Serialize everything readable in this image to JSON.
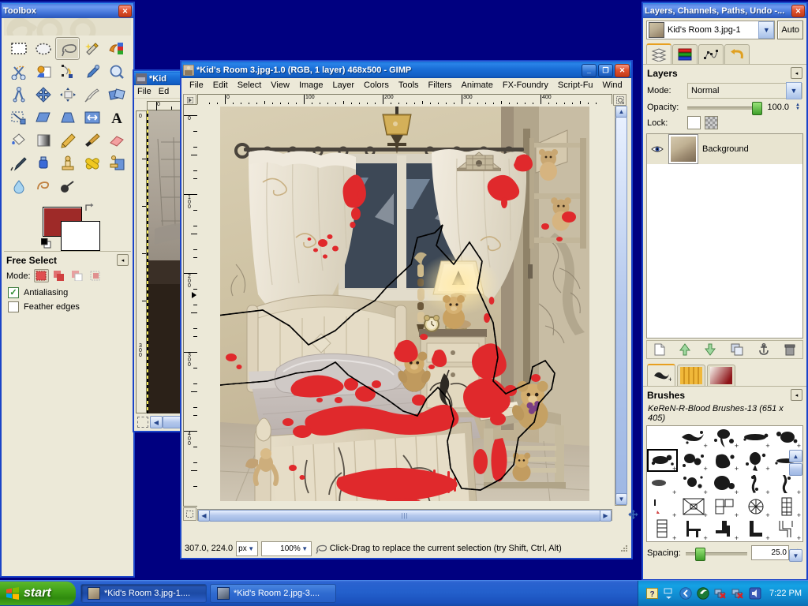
{
  "desktop": {
    "background_color": "#000080"
  },
  "toolbox": {
    "title": "Toolbox",
    "close_label": "✕",
    "tools": [
      {
        "name": "rect-select-tool",
        "label": "Rectangle Select",
        "selected": false
      },
      {
        "name": "ellipse-select-tool",
        "label": "Ellipse Select",
        "selected": false
      },
      {
        "name": "free-select-tool",
        "label": "Free Select",
        "selected": true
      },
      {
        "name": "fuzzy-select-tool",
        "label": "Fuzzy Select",
        "selected": false
      },
      {
        "name": "select-by-color-tool",
        "label": "Select by Color",
        "selected": false
      },
      {
        "name": "scissors-select-tool",
        "label": "Scissors Select",
        "selected": false
      },
      {
        "name": "foreground-select-tool",
        "label": "Foreground Select",
        "selected": false
      },
      {
        "name": "paths-tool",
        "label": "Paths",
        "selected": false
      },
      {
        "name": "color-picker-tool",
        "label": "Color Picker",
        "selected": false
      },
      {
        "name": "zoom-tool",
        "label": "Zoom",
        "selected": false
      },
      {
        "name": "measure-tool",
        "label": "Measure",
        "selected": false
      },
      {
        "name": "move-tool",
        "label": "Move",
        "selected": false
      },
      {
        "name": "alignment-tool",
        "label": "Alignment",
        "selected": false
      },
      {
        "name": "crop-tool",
        "label": "Crop",
        "selected": false
      },
      {
        "name": "rotate-tool",
        "label": "Rotate",
        "selected": false
      },
      {
        "name": "scale-tool",
        "label": "Scale",
        "selected": false
      },
      {
        "name": "shear-tool",
        "label": "Shear",
        "selected": false
      },
      {
        "name": "perspective-tool",
        "label": "Perspective",
        "selected": false
      },
      {
        "name": "flip-tool",
        "label": "Flip",
        "selected": false
      },
      {
        "name": "text-tool",
        "label": "Text",
        "selected": false
      },
      {
        "name": "bucket-fill-tool",
        "label": "Bucket Fill",
        "selected": false
      },
      {
        "name": "gradient-tool",
        "label": "Blend",
        "selected": false
      },
      {
        "name": "pencil-tool",
        "label": "Pencil",
        "selected": false
      },
      {
        "name": "paintbrush-tool",
        "label": "Paintbrush",
        "selected": false
      },
      {
        "name": "eraser-tool",
        "label": "Eraser",
        "selected": false
      },
      {
        "name": "airbrush-tool",
        "label": "Airbrush",
        "selected": false
      },
      {
        "name": "ink-tool",
        "label": "Ink",
        "selected": false
      },
      {
        "name": "clone-tool",
        "label": "Clone",
        "selected": false
      },
      {
        "name": "heal-tool",
        "label": "Heal",
        "selected": false
      },
      {
        "name": "perspective-clone-tool",
        "label": "Perspective Clone",
        "selected": false
      },
      {
        "name": "blur-sharpen-tool",
        "label": "Blur / Sharpen",
        "selected": false
      },
      {
        "name": "smudge-tool",
        "label": "Smudge",
        "selected": false
      },
      {
        "name": "dodge-burn-tool",
        "label": "Dodge / Burn",
        "selected": false
      }
    ],
    "colors": {
      "foreground": "#9e2a28",
      "background": "#ffffff"
    },
    "options": {
      "title": "Free Select",
      "collapse_label": "◂",
      "mode_label": "Mode:",
      "modes": [
        {
          "name": "mode-replace",
          "selected": true
        },
        {
          "name": "mode-add",
          "selected": false
        },
        {
          "name": "mode-subtract",
          "selected": false
        },
        {
          "name": "mode-intersect",
          "selected": false
        }
      ],
      "antialiasing": {
        "label": "Antialiasing",
        "checked": true
      },
      "feather_edges": {
        "label": "Feather edges",
        "checked": false
      }
    }
  },
  "background_window": {
    "title": "*Kid",
    "menu": [
      "File",
      "Ed"
    ],
    "ruler_labels": [
      "0",
      "0",
      "300"
    ]
  },
  "main_window": {
    "title": "*Kid's Room 3.jpg-1.0 (RGB, 1 layer) 468x500 - GIMP",
    "min_label": "_",
    "max_label": "❐",
    "close_label": "✕",
    "menu": [
      "File",
      "Edit",
      "Select",
      "View",
      "Image",
      "Layer",
      "Colors",
      "Tools",
      "Filters",
      "Animate",
      "FX-Foundry",
      "Script-Fu",
      "Wind"
    ],
    "h_ruler_labels": [
      "0",
      "100",
      "200",
      "300",
      "400"
    ],
    "v_ruler_labels": [
      "0",
      "100",
      "200",
      "300",
      "400"
    ],
    "status": {
      "position": "307.0, 224.0",
      "unit": "px",
      "zoom": "100%",
      "hint": "Click-Drag to replace the current selection (try Shift, Ctrl, Alt)"
    }
  },
  "dock": {
    "title": "Layers, Channels, Paths, Undo -...",
    "close_label": "✕",
    "image_name": "Kid's Room 3.jpg-1",
    "auto_label": "Auto",
    "tabs": [
      {
        "name": "tab-layers",
        "label": "Layers",
        "active": true
      },
      {
        "name": "tab-channels",
        "label": "Channels",
        "active": false
      },
      {
        "name": "tab-paths",
        "label": "Paths",
        "active": false
      },
      {
        "name": "tab-undo-history",
        "label": "Undo History",
        "active": false
      }
    ],
    "layers_panel": {
      "title": "Layers",
      "collapse_label": "◂",
      "mode_label": "Mode:",
      "mode_value": "Normal",
      "opacity_label": "Opacity:",
      "opacity_value": "100.0",
      "lock_label": "Lock:",
      "layers": [
        {
          "name": "Background",
          "visible": true
        }
      ]
    },
    "layer_buttons": [
      {
        "name": "new-layer-button"
      },
      {
        "name": "raise-layer-button"
      },
      {
        "name": "lower-layer-button"
      },
      {
        "name": "duplicate-layer-button"
      },
      {
        "name": "anchor-layer-button"
      },
      {
        "name": "delete-layer-button"
      }
    ],
    "brush_tabs": [
      {
        "name": "tab-brushes",
        "active": true
      },
      {
        "name": "tab-patterns",
        "active": false
      },
      {
        "name": "tab-gradients",
        "active": false
      }
    ],
    "brushes_panel": {
      "title": "Brushes",
      "collapse_label": "◂",
      "selected_brush": "KeReN-R-Blood Brushes-13 (651 x 405)",
      "spacing_label": "Spacing:",
      "spacing_value": "25.0"
    }
  },
  "taskbar": {
    "start_label": "start",
    "items": [
      {
        "name": "taskbar-item-kids-room-3",
        "label": "*Kid's Room 3.jpg-1....",
        "active": true
      },
      {
        "name": "taskbar-item-kids-room-2",
        "label": "*Kid's Room 2.jpg-3....",
        "active": false
      }
    ],
    "clock": "7:22 PM"
  }
}
